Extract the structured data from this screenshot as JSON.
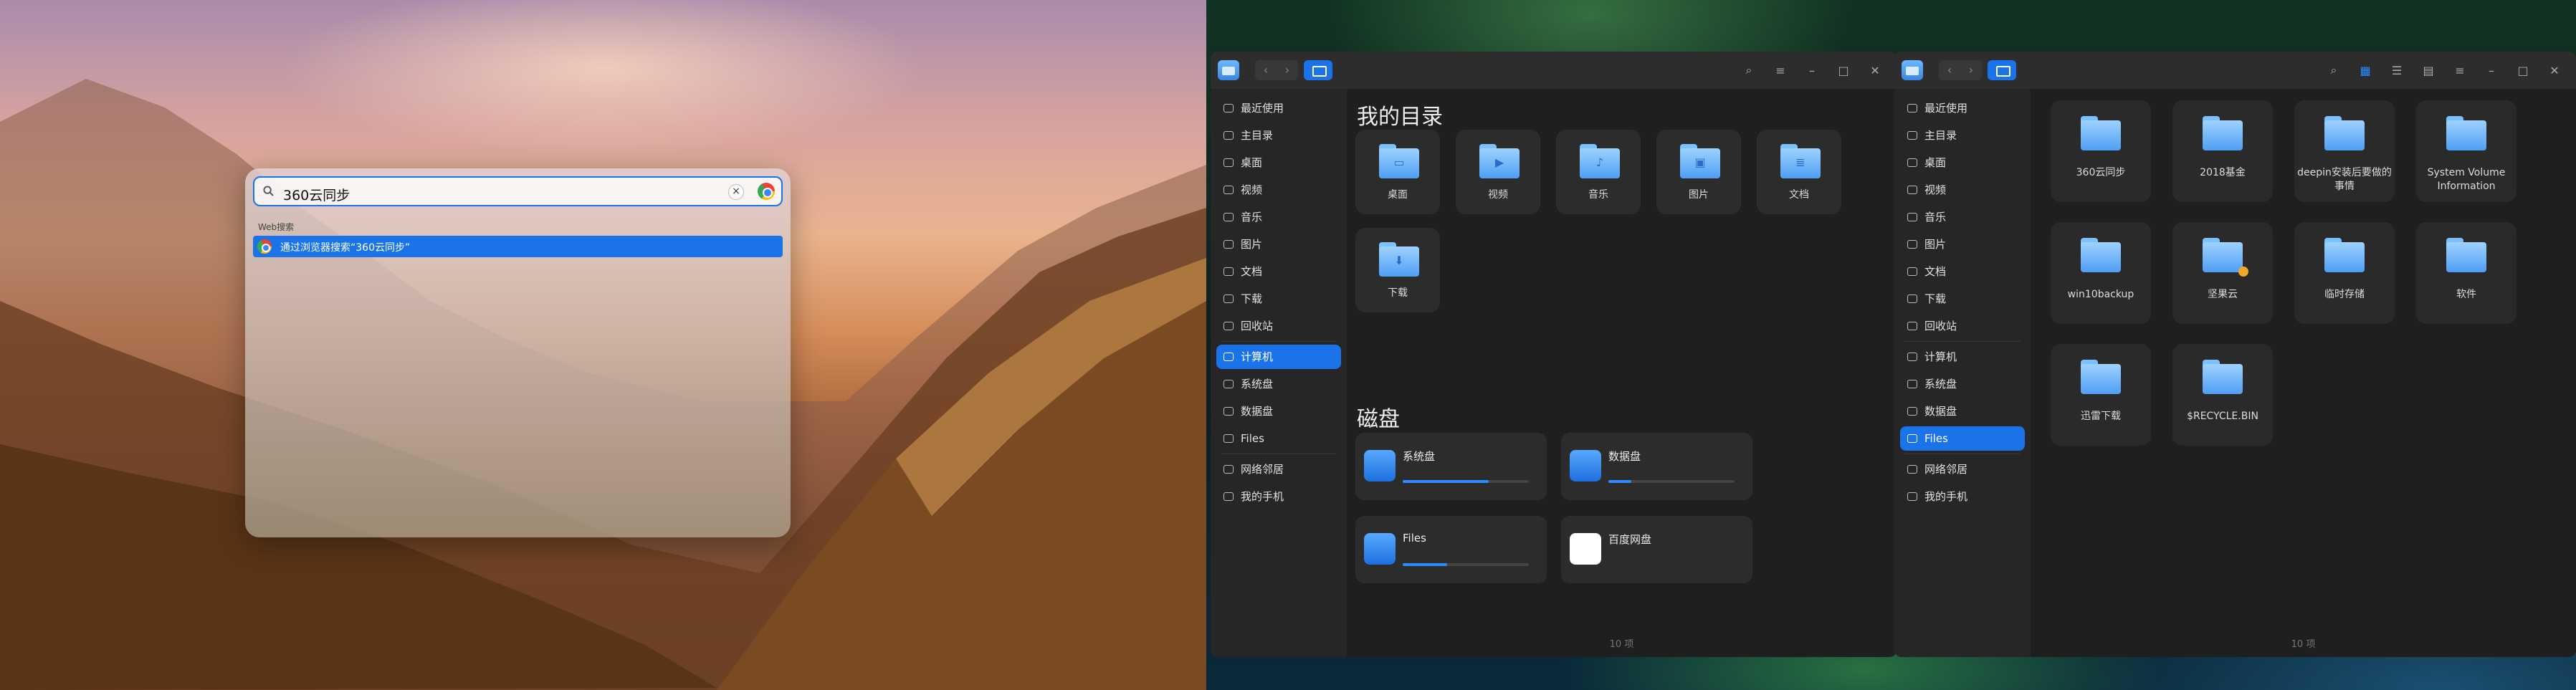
{
  "launcher": {
    "query": "360云同步",
    "section_label": "Web搜索",
    "result_text": "通过浏览器搜索“360云同步”"
  },
  "fm1": {
    "sidebar": [
      {
        "label": "最近使用",
        "icon": "clock-icon"
      },
      {
        "label": "主目录",
        "icon": "home-icon"
      },
      {
        "label": "桌面",
        "icon": "desktop-icon"
      },
      {
        "label": "视频",
        "icon": "video-icon"
      },
      {
        "label": "音乐",
        "icon": "music-icon"
      },
      {
        "label": "图片",
        "icon": "picture-icon"
      },
      {
        "label": "文档",
        "icon": "document-icon"
      },
      {
        "label": "下载",
        "icon": "download-icon"
      },
      {
        "label": "回收站",
        "icon": "trash-icon"
      },
      {
        "label": "计算机",
        "icon": "computer-icon",
        "selected": true
      },
      {
        "label": "系统盘",
        "icon": "drive-icon"
      },
      {
        "label": "数据盘",
        "icon": "drive-icon"
      },
      {
        "label": "Files",
        "icon": "drive-icon"
      },
      {
        "label": "网络邻居",
        "icon": "network-icon"
      },
      {
        "label": "我的手机",
        "icon": "phone-icon"
      }
    ],
    "dirs_title": "我的目录",
    "dirs": [
      {
        "label": "桌面",
        "icon": "desktop-folder-icon"
      },
      {
        "label": "视频",
        "icon": "video-folder-icon"
      },
      {
        "label": "音乐",
        "icon": "music-folder-icon"
      },
      {
        "label": "图片",
        "icon": "picture-folder-icon"
      },
      {
        "label": "文档",
        "icon": "document-folder-icon"
      },
      {
        "label": "下载",
        "icon": "download-folder-icon"
      }
    ],
    "disks_title": "磁盘",
    "disks": [
      {
        "label": "系统盘",
        "usage": 0.68
      },
      {
        "label": "数据盘",
        "usage": 0.18
      },
      {
        "label": "Files",
        "usage": 0.35
      },
      {
        "label": "百度网盘",
        "usage": null
      }
    ],
    "status": "10 项"
  },
  "fm2": {
    "sidebar": [
      {
        "label": "最近使用"
      },
      {
        "label": "主目录"
      },
      {
        "label": "桌面"
      },
      {
        "label": "视频"
      },
      {
        "label": "音乐"
      },
      {
        "label": "图片"
      },
      {
        "label": "文档"
      },
      {
        "label": "下载"
      },
      {
        "label": "回收站"
      },
      {
        "label": "计算机"
      },
      {
        "label": "系统盘"
      },
      {
        "label": "数据盘"
      },
      {
        "label": "Files",
        "selected": true
      },
      {
        "label": "网络邻居"
      },
      {
        "label": "我的手机"
      }
    ],
    "folders": [
      {
        "label": "360云同步"
      },
      {
        "label": "2018基金"
      },
      {
        "label": "deepin安装后要做的事情"
      },
      {
        "label": "System Volume Information"
      },
      {
        "label": "win10backup"
      },
      {
        "label": "坚果云"
      },
      {
        "label": "临时存储"
      },
      {
        "label": "软件"
      },
      {
        "label": "迅雷下载"
      },
      {
        "label": "$RECYCLE.BIN"
      }
    ],
    "status": "10 项"
  }
}
